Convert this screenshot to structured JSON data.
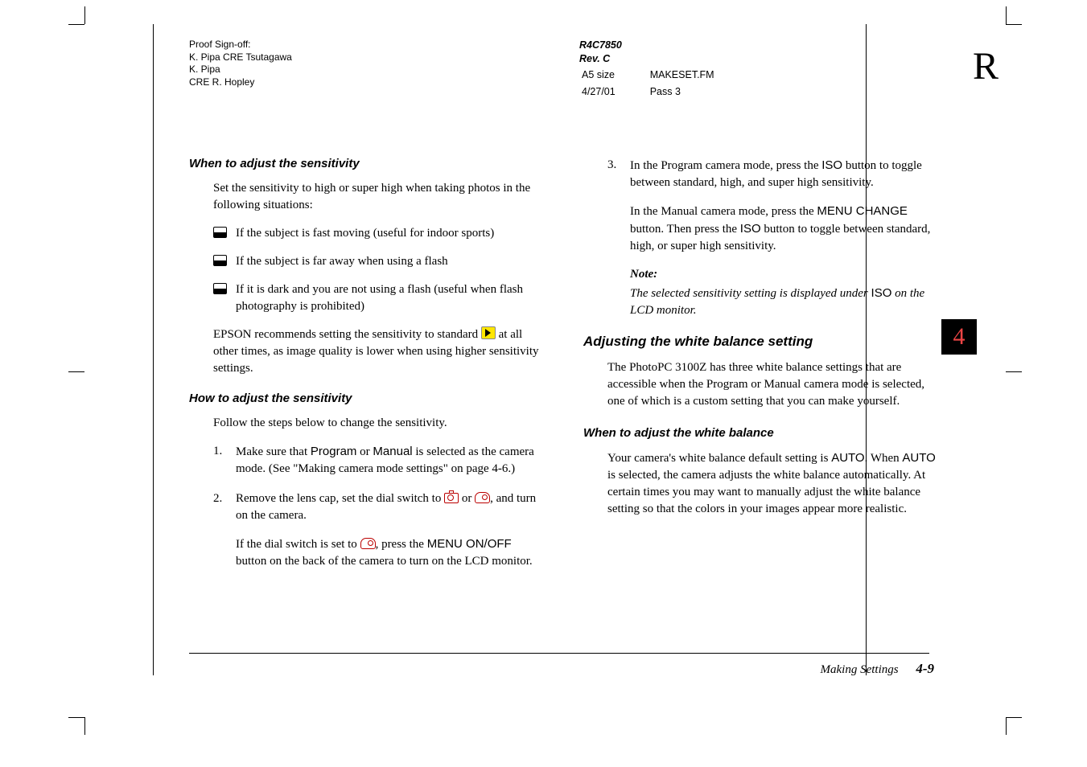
{
  "header": {
    "line1": "Proof Sign-off:",
    "line2": "K. Pipa CRE Tsutagawa",
    "line3": "K. Pipa",
    "line4": "CRE R. Hopley"
  },
  "center": {
    "code": "R4C7850",
    "rev": "Rev. C",
    "size": "A5 size",
    "file": "MAKESET.FM",
    "date": "4/27/01",
    "pass": "Pass 3"
  },
  "bigletter": "R",
  "boxnum": "4",
  "left": {
    "h1": "When to adjust the sensitivity",
    "p1": "Set the sensitivity to high or super high when taking photos in the following situations:",
    "b1": "If the subject is fast moving (useful for indoor sports)",
    "b2": "If the subject is far away when using a flash",
    "b3": "If it is dark and you are not using a flash (useful when flash photography is prohibited)",
    "p2a": "EPSON recommends setting the sensitivity to standard ",
    "p2b": " at all other times, as image quality is lower when using higher sensitivity settings.",
    "h2": "How to adjust the sensitivity",
    "p3": "Follow the steps below to change the sensitivity.",
    "s1a": "Make sure that ",
    "s1prog": "Program",
    "s1or": " or ",
    "s1man": "Manual",
    "s1b": " is selected as the camera mode. (See \"Making camera mode settings\" on page 4-6.)",
    "s2a": "Remove the lens cap, set the dial switch to ",
    "s2or": " or ",
    "s2b": ", and turn on the camera.",
    "s2ia": "If the dial switch is set to ",
    "s2ib": ", press the ",
    "s2menu": "MENU ON/OFF",
    "s2ic": " button on the back of the camera to turn on the LCD monitor."
  },
  "right": {
    "s3a": "In the Program camera mode, press the ",
    "iso": "ISO",
    "s3b": " button to toggle between standard, high, and super high sensitivity.",
    "s3ia": "In the Manual camera mode, press the ",
    "menuchange": "MENU CHANGE",
    "s3ib": " button. Then press the ",
    "s3ic": " button to toggle between standard, high, or super high sensitivity.",
    "notelabel": "Note:",
    "notea": "The selected sensitivity setting is displayed under ",
    "noteb": " on the LCD monitor.",
    "h3": "Adjusting the white balance setting",
    "p4": "The PhotoPC 3100Z has three white balance settings that are accessible when the Program or Manual camera mode is selected, one of which is a custom setting that you can make yourself.",
    "h4": "When to adjust the white balance",
    "p5a": "Your camera's white balance default setting is ",
    "auto": "AUTO",
    "p5b": ". When ",
    "p5c": " is selected, the camera adjusts the white balance automatically. At certain times you may want to manually adjust the white balance setting so that the colors in your images appear more realistic."
  },
  "footer": {
    "text": "Making Settings",
    "page": "4-9"
  }
}
